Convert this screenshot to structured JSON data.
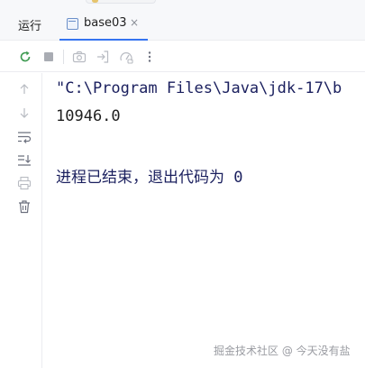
{
  "panel": {
    "run_label": "运行",
    "active_tab": {
      "title": "base03",
      "close_glyph": "×",
      "icon": "java-class-file-icon"
    }
  },
  "toolbar": {
    "buttons": [
      {
        "name": "rerun-button",
        "icon": "rerun-icon"
      },
      {
        "name": "stop-button",
        "icon": "stop-icon"
      },
      {
        "name": "screenshot-button",
        "icon": "camera-icon"
      },
      {
        "name": "exit-button",
        "icon": "exit-icon"
      },
      {
        "name": "profiler-button",
        "icon": "gauge-icon"
      },
      {
        "name": "more-options-button",
        "icon": "more-vertical-icon"
      }
    ]
  },
  "gutter": {
    "buttons": [
      {
        "name": "scroll-up-button",
        "icon": "arrow-up-icon"
      },
      {
        "name": "scroll-down-button",
        "icon": "arrow-down-icon"
      },
      {
        "name": "soft-wrap-button",
        "icon": "soft-wrap-icon"
      },
      {
        "name": "scroll-to-end-button",
        "icon": "scroll-to-end-icon"
      },
      {
        "name": "print-button",
        "icon": "printer-icon"
      },
      {
        "name": "clear-all-button",
        "icon": "trash-icon"
      }
    ]
  },
  "console": {
    "command_line": "\"C:\\Program Files\\Java\\jdk-17\\b",
    "output_line": "10946.0",
    "exit_line": "进程已结束，退出代码为 0"
  },
  "watermark": "掘金技术社区 @ 今天没有盐",
  "colors": {
    "accent": "#3574f0",
    "console_command": "#1a1f5e",
    "rerun_green": "#3d9a50"
  }
}
